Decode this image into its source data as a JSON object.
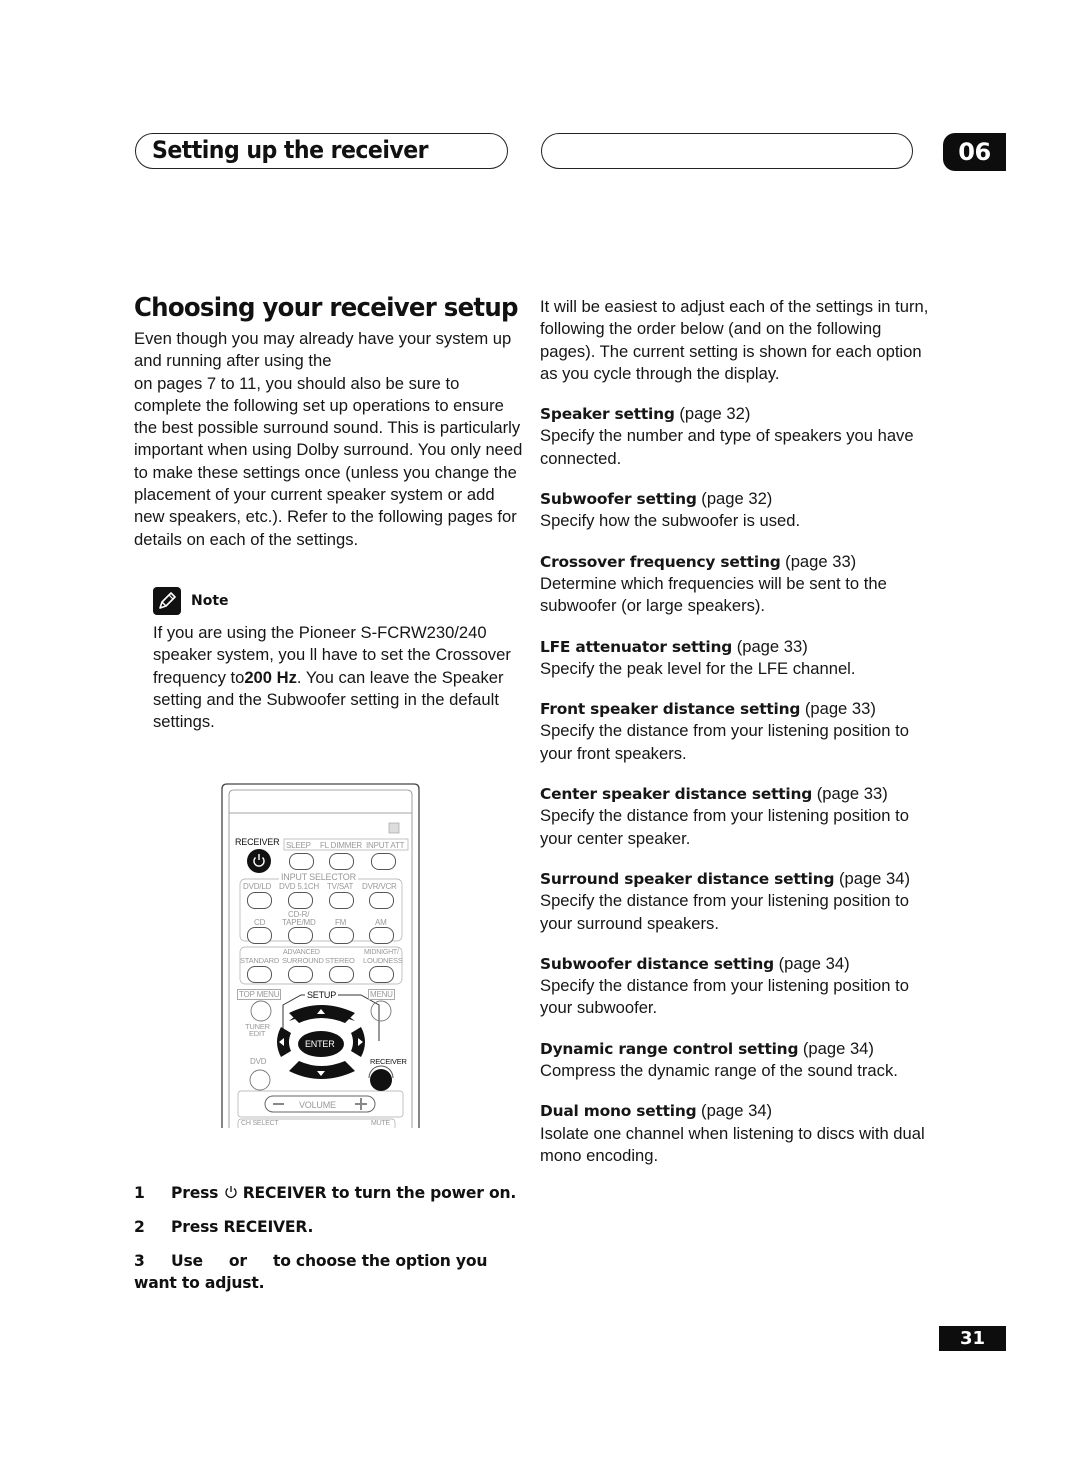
{
  "header": {
    "section_title": "Setting up the receiver",
    "chapter_number": "06"
  },
  "main": {
    "title": "Choosing your receiver setup",
    "intro_lines": [
      "Even though you may already have your system up and running after using the",
      "on pages 7 to 11, you should also be sure to complete the following set up operations to ensure the best possible surround sound. This is particularly important when using Dolby surround. You only need to make these settings once (unless you change the placement of your current speaker system or add new speakers, etc.). Refer to the following pages for details on each of the settings."
    ],
    "note": {
      "label": "Note",
      "icon": "pencil-icon",
      "text_before": "If you are using the Pioneer S-FCRW230/240 speaker system, you ll have to set the Crossover frequency to",
      "text_bold": "200 Hz",
      "text_after": ". You can leave the Speaker setting and the Subwoofer setting in the default settings."
    },
    "steps": [
      {
        "num": "1",
        "pre": "Press",
        "icon": "power-icon",
        "post": "RECEIVER to turn the power on."
      },
      {
        "num": "2",
        "text": "Press RECEIVER."
      },
      {
        "num": "3",
        "pre": "Use",
        "mid": "or",
        "post": "to choose the option you want to adjust."
      }
    ]
  },
  "remote": {
    "labels": {
      "receiver_top": "RECEIVER",
      "sleep": "SLEEP",
      "fl_dimmer": "FL DIMMER",
      "input_att": "INPUT ATT",
      "input_selector": "INPUT SELECTOR",
      "dvd_ld": "DVD/LD",
      "dvd_51ch": "DVD 5.1CH",
      "tv_sat": "TV/SAT",
      "dvr_vcr": "DVR/VCR",
      "cd": "CD",
      "cdr_tape_1": "CD-R/",
      "cdr_tape_2": "TAPE/MD",
      "fm": "FM",
      "am": "AM",
      "standard": "STANDARD",
      "advanced_1": "ADVANCED",
      "advanced_2": "SURROUND",
      "stereo": "STEREO",
      "midnight_1": "MIDNIGHT/",
      "midnight_2": "LOUDNESS",
      "top_menu": "TOP MENU",
      "setup": "SETUP",
      "menu": "MENU",
      "tuner_1": "TUNER",
      "tuner_2": "EDIT",
      "enter": "ENTER",
      "dvd": "DVD",
      "receiver_bottom": "RECEIVER",
      "volume": "VOLUME",
      "ch_select": "CH SELECT",
      "mute": "MUTE"
    }
  },
  "right": {
    "intro": "It will be easiest to adjust each of the settings in turn, following the order below (and on the following pages). The current setting is shown for each option as you cycle through the display.",
    "settings": [
      {
        "title": "Speaker setting",
        "page": "(page 32)",
        "desc": "Specify the number and type of speakers you have connected."
      },
      {
        "title": "Subwoofer setting",
        "page": "(page 32)",
        "desc": "Specify how the subwoofer is used."
      },
      {
        "title": "Crossover frequency setting",
        "page": "(page 33)",
        "desc": "Determine which frequencies will be sent to the subwoofer (or large speakers)."
      },
      {
        "title": "LFE attenuator setting",
        "page": "(page 33)",
        "desc": "Specify the peak level for the LFE channel."
      },
      {
        "title": "Front speaker distance setting",
        "page": "(page 33)",
        "desc": "Specify the distance from your listening position to your front speakers."
      },
      {
        "title": "Center speaker distance setting",
        "page": "(page 33)",
        "desc": "Specify the distance from your listening position to your center speaker."
      },
      {
        "title": "Surround speaker distance setting",
        "page": "(page 34)",
        "desc": "Specify the distance from your listening position to your surround speakers."
      },
      {
        "title": "Subwoofer distance setting",
        "page": "(page 34)",
        "desc": "Specify the distance from your listening position to your subwoofer."
      },
      {
        "title": "Dynamic range control setting",
        "page": "(page 34)",
        "desc": "Compress the dynamic range of the sound track."
      },
      {
        "title": "Dual mono setting",
        "page": "(page 34)",
        "desc": "Isolate one channel when listening to discs with dual mono encoding."
      }
    ]
  },
  "footer": {
    "page_number": "31"
  }
}
